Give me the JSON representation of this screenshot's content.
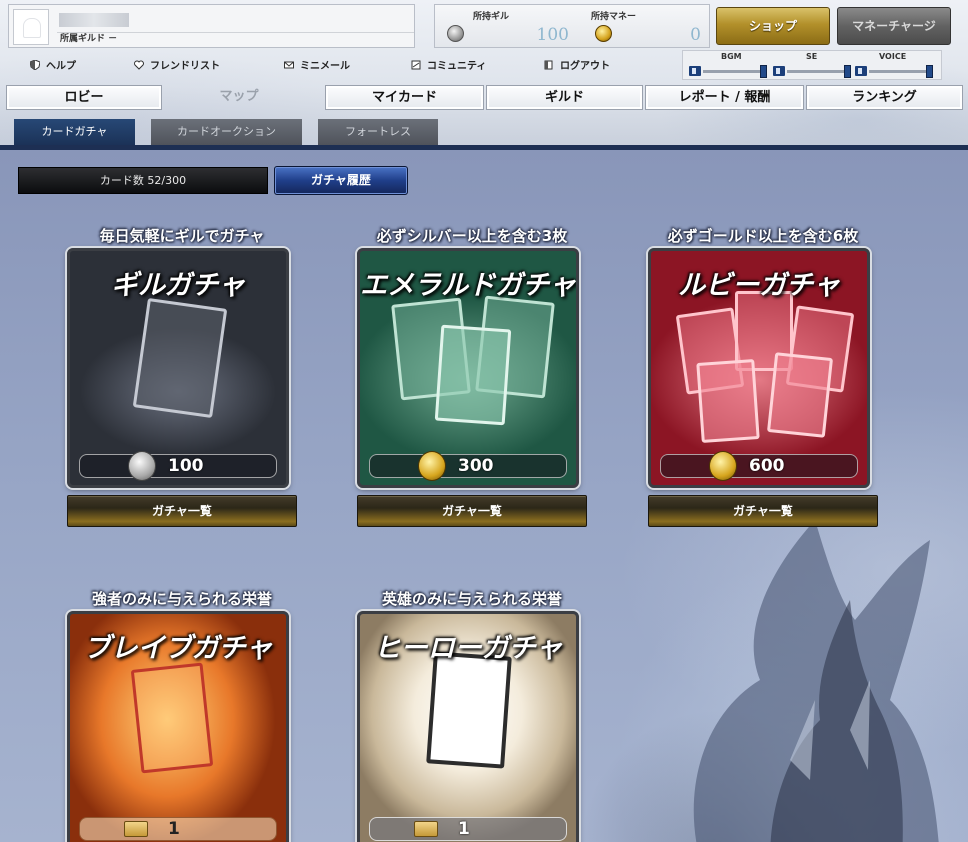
{
  "header": {
    "guild_label": "所属ギルド －",
    "currency": {
      "gil_label": "所持ギル",
      "gil_value": "100",
      "money_label": "所持マネー",
      "money_value": "0"
    },
    "shop_label": "ショップ",
    "money_charge_label": "マネーチャージ"
  },
  "util_links": [
    {
      "label": "ヘルプ",
      "icon": "shield-icon"
    },
    {
      "label": "フレンドリスト",
      "icon": "heart-icon"
    },
    {
      "label": "ミニメール",
      "icon": "mail-icon"
    },
    {
      "label": "コミュニティ",
      "icon": "community-icon"
    },
    {
      "label": "ログアウト",
      "icon": "logout-icon"
    }
  ],
  "audio": {
    "bgm": "BGM",
    "se": "SE",
    "voice": "VOICE"
  },
  "nav": [
    "ロビー",
    "マップ",
    "マイカード",
    "ギルド",
    "レポート / 報酬",
    "ランキング"
  ],
  "sub_tabs": [
    "カードガチャ",
    "カードオークション",
    "フォートレス"
  ],
  "content": {
    "card_count": "カード数  52/300",
    "history_label": "ガチャ履歴"
  },
  "gachas": [
    {
      "tagline": "毎日気軽にギルでガチャ",
      "title": "ギルガチャ",
      "price": "100",
      "currency_icon": "silver-coin-icon",
      "list_label": "ガチャ一覧",
      "accent": "#4a505c"
    },
    {
      "tagline": "必ずシルバー以上を含む3枚",
      "title": "エメラルドガチャ",
      "price": "300",
      "currency_icon": "gold-coin-icon",
      "list_label": "ガチャ一覧",
      "accent": "#2f7c63"
    },
    {
      "tagline": "必ずゴールド以上を含む6枚",
      "title": "ルビーガチャ",
      "price": "600",
      "currency_icon": "gold-coin-icon",
      "list_label": "ガチャ一覧",
      "accent": "#b22634"
    },
    {
      "tagline": "強者のみに与えられる栄誉",
      "title": "ブレイブガチャ",
      "price": "1",
      "currency_icon": "ticket-icon",
      "accent": "#e06a24"
    },
    {
      "tagline": "英雄のみに与えられる栄誉",
      "title": "ヒーローガチャ",
      "price": "1",
      "currency_icon": "ticket-icon",
      "accent": "#d9d3c4"
    }
  ]
}
